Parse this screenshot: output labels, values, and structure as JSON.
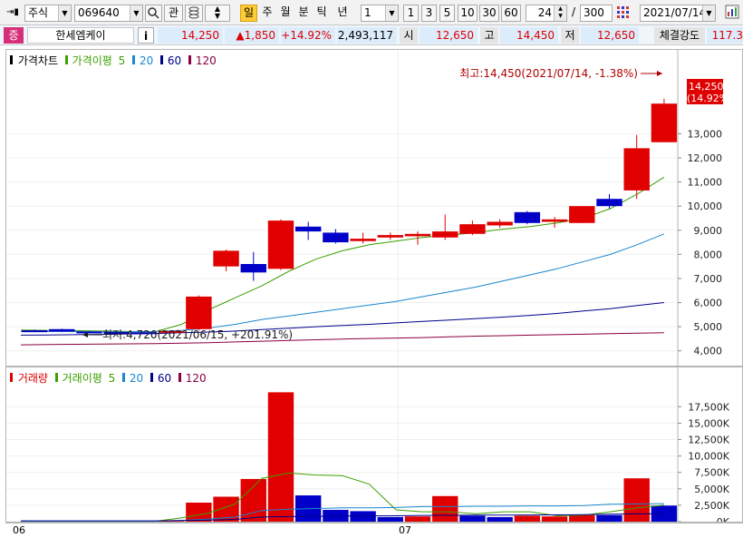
{
  "toolbar": {
    "market": "주식",
    "code": "069640",
    "gwan_label": "관",
    "mode_selected": "일",
    "modes": [
      "주",
      "월",
      "분",
      "틱",
      "년"
    ],
    "interval_value": "1",
    "periods": [
      "1",
      "3",
      "5",
      "10",
      "30",
      "60"
    ],
    "count_value": "24",
    "total_value": "300",
    "date_value": "2021/07/14"
  },
  "info": {
    "badge": "증",
    "name": "한세엠케이",
    "info_button": "i",
    "price": "14,250",
    "change": "▲1,850",
    "change_pct": "+14.92%",
    "volume": "2,493,117",
    "open_label": "시",
    "open_value": "12,650",
    "high_label": "고",
    "high_value": "14,450",
    "low_label": "저",
    "low_value": "12,650",
    "strength_label": "체결강도",
    "strength_value": "117.3"
  },
  "price_panel": {
    "legend_title": "가격차트",
    "legend_ma_label": "가격이평",
    "ma_periods": [
      "5",
      "20",
      "60",
      "120"
    ],
    "high_annotation": "최고:14,450(2021/07/14, -1.38%)",
    "low_annotation": "최저:4,720(2021/06/15, +201.91%)",
    "last_price_tag": "14,250",
    "last_pct_tag": "(14.92%)"
  },
  "volume_panel": {
    "legend_title": "거래량",
    "legend_ma_label": "거래이평",
    "ma_periods": [
      "5",
      "20",
      "60",
      "120"
    ]
  },
  "x_labels": [
    "06",
    "07"
  ],
  "colors": {
    "up": "#e00000",
    "down": "#0000c8",
    "ma5": "#3c9f00",
    "ma20": "#1a86d0",
    "ma60": "#00008b",
    "ma120": "#8b0040",
    "annotation": "#b00000",
    "tag_bg": "#e00000"
  },
  "chart_data": [
    {
      "type": "candlestick",
      "title": "가격차트",
      "ylim": [
        3500,
        15800
      ],
      "y_ticks": [
        4000,
        5000,
        6000,
        7000,
        8000,
        9000,
        10000,
        11000,
        12000,
        13000
      ],
      "y_tick_labels": [
        "4,000",
        "5,000",
        "6,000",
        "7,000",
        "8,000",
        "9,000",
        "10,000",
        "11,000",
        "12,000",
        "13,000"
      ],
      "candles": [
        {
          "o": 4850,
          "h": 4880,
          "l": 4800,
          "c": 4820
        },
        {
          "o": 4900,
          "h": 4920,
          "l": 4790,
          "c": 4800
        },
        {
          "o": 4800,
          "h": 4820,
          "l": 4760,
          "c": 4770
        },
        {
          "o": 4780,
          "h": 4800,
          "l": 4740,
          "c": 4760
        },
        {
          "o": 4770,
          "h": 4800,
          "l": 4720,
          "c": 4760
        },
        {
          "o": 4760,
          "h": 4840,
          "l": 4740,
          "c": 4820
        },
        {
          "o": 4900,
          "h": 6300,
          "l": 4850,
          "c": 6250
        },
        {
          "o": 7500,
          "h": 8200,
          "l": 7300,
          "c": 8150
        },
        {
          "o": 7600,
          "h": 8100,
          "l": 6900,
          "c": 7250
        },
        {
          "o": 7400,
          "h": 9450,
          "l": 7350,
          "c": 9400
        },
        {
          "o": 9150,
          "h": 9350,
          "l": 8600,
          "c": 8950
        },
        {
          "o": 8900,
          "h": 9050,
          "l": 8450,
          "c": 8500
        },
        {
          "o": 8550,
          "h": 8900,
          "l": 8450,
          "c": 8650
        },
        {
          "o": 8700,
          "h": 8900,
          "l": 8600,
          "c": 8800
        },
        {
          "o": 8750,
          "h": 8950,
          "l": 8400,
          "c": 8850
        },
        {
          "o": 8700,
          "h": 9650,
          "l": 8600,
          "c": 8950
        },
        {
          "o": 8850,
          "h": 9400,
          "l": 8800,
          "c": 9250
        },
        {
          "o": 9200,
          "h": 9450,
          "l": 9100,
          "c": 9350
        },
        {
          "o": 9750,
          "h": 9800,
          "l": 9250,
          "c": 9300
        },
        {
          "o": 9350,
          "h": 9550,
          "l": 9100,
          "c": 9450
        },
        {
          "o": 9300,
          "h": 10000,
          "l": 9300,
          "c": 10000
        },
        {
          "o": 10300,
          "h": 10500,
          "l": 9900,
          "c": 10000
        },
        {
          "o": 10650,
          "h": 12950,
          "l": 10300,
          "c": 12400
        },
        {
          "o": 12650,
          "h": 14450,
          "l": 12650,
          "c": 14250
        }
      ],
      "ma": {
        "ma5": [
          4860,
          4850,
          4840,
          4820,
          4800,
          4790,
          5100,
          5700,
          6200,
          6700,
          7300,
          7800,
          8150,
          8400,
          8550,
          8700,
          8800,
          8900,
          9050,
          9150,
          9300,
          9500,
          9900,
          10500,
          11200
        ],
        "ma20": [
          4800,
          4800,
          4800,
          4790,
          4790,
          4800,
          4850,
          4950,
          5100,
          5300,
          5450,
          5600,
          5750,
          5900,
          6050,
          6250,
          6450,
          6650,
          6900,
          7150,
          7400,
          7700,
          8000,
          8400,
          8850
        ],
        "ma60": [
          4650,
          4660,
          4670,
          4680,
          4700,
          4720,
          4750,
          4780,
          4820,
          4880,
          4940,
          5000,
          5050,
          5100,
          5160,
          5220,
          5280,
          5340,
          5400,
          5470,
          5550,
          5650,
          5750,
          5880,
          6000
        ],
        "ma120": [
          4250,
          4260,
          4270,
          4280,
          4290,
          4300,
          4320,
          4340,
          4370,
          4400,
          4430,
          4460,
          4490,
          4510,
          4530,
          4550,
          4580,
          4610,
          4630,
          4650,
          4670,
          4690,
          4710,
          4730,
          4750
        ]
      }
    },
    {
      "type": "bar",
      "title": "거래량",
      "ylim": [
        0,
        21000
      ],
      "y_ticks": [
        0,
        2500,
        5000,
        7500,
        10000,
        12500,
        15000,
        17500
      ],
      "y_tick_labels": [
        "0K",
        "2,500K",
        "5,000K",
        "7,500K",
        "10,000K",
        "12,500K",
        "15,000K",
        "17,500K"
      ],
      "values_k": [
        60,
        80,
        60,
        50,
        40,
        100,
        2900,
        3800,
        6500,
        19700,
        4000,
        1800,
        1600,
        700,
        800,
        3900,
        900,
        700,
        900,
        800,
        1000,
        1000,
        6600,
        2450
      ],
      "up": [
        false,
        false,
        false,
        false,
        false,
        true,
        true,
        true,
        true,
        true,
        false,
        false,
        false,
        false,
        true,
        true,
        false,
        false,
        true,
        true,
        true,
        false,
        true,
        false
      ],
      "ma": {
        "ma5": [
          60,
          60,
          60,
          60,
          60,
          60,
          600,
          1300,
          2700,
          6600,
          7400,
          7100,
          7000,
          5700,
          1800,
          1500,
          1500,
          1200,
          1500,
          1500,
          900,
          1000,
          1500,
          2100,
          2500
        ],
        "ma20": [
          80,
          80,
          80,
          80,
          80,
          80,
          200,
          400,
          700,
          1700,
          1900,
          2000,
          2100,
          2100,
          2150,
          2300,
          2300,
          2350,
          2350,
          2400,
          2400,
          2450,
          2650,
          2700,
          2750
        ],
        "ma60": [
          120,
          120,
          120,
          120,
          120,
          120,
          160,
          240,
          350,
          700,
          780,
          820,
          860,
          880,
          900,
          950,
          970,
          990,
          1000,
          1020,
          1040,
          1060,
          1150,
          1190,
          1220
        ]
      }
    }
  ]
}
